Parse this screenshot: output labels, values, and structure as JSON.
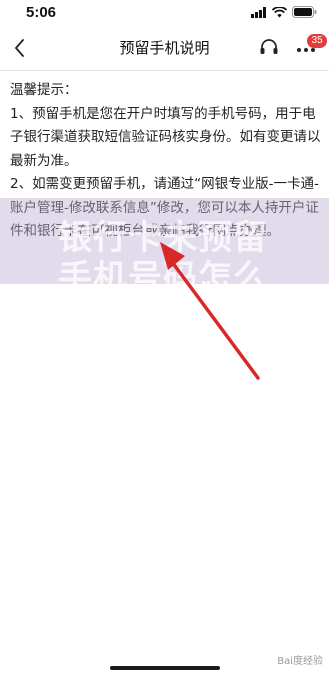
{
  "status_bar": {
    "time": "5:06"
  },
  "nav": {
    "title": "预留手机说明",
    "badge_count": "35"
  },
  "content": {
    "heading": "温馨提示：",
    "item1": "1、预留手机是您在开户时填写的手机号码，用于电子银行渠道获取短信验证码核实身份。如有变更请以最新为准。",
    "item2": "2、如需变更预留手机，请通过“网银专业版-一卡通-账户管理-修改联系信息”修改，您可以本人持开户证件和银行卡在可视柜台或亲临我行网点办理。"
  },
  "watermark": {
    "line1": "银行卡未预留",
    "line2": "手机号码怎么",
    "footer": "Bai度经验"
  },
  "colors": {
    "accent_arrow": "#d8282a",
    "badge": "#e23c3c"
  }
}
